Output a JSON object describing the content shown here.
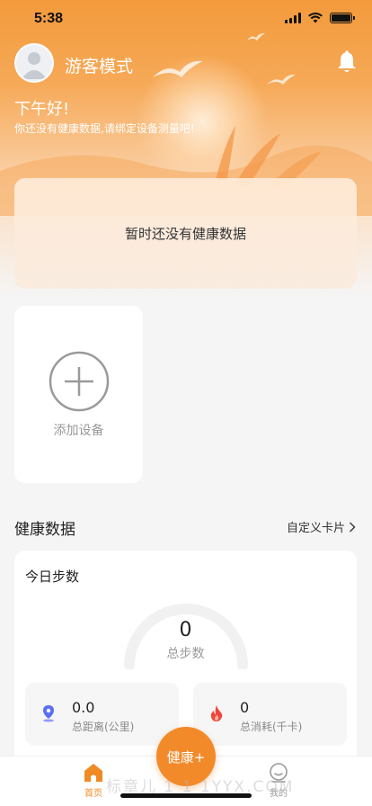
{
  "status_bar": {
    "time": "5:38"
  },
  "header": {
    "username": "游客模式",
    "greeting": "下午好!",
    "greeting_sub": "你还没有健康数据,请绑定设备测量吧!"
  },
  "data_card": {
    "empty_text": "暂时还没有健康数据"
  },
  "add_device": {
    "label": "添加设备"
  },
  "health_section": {
    "title": "健康数据",
    "custom_link": "自定义卡片",
    "steps_card": {
      "title": "今日步数",
      "steps_value": "0",
      "steps_label": "总步数",
      "distance": {
        "value": "0.0",
        "label": "总距离(公里)"
      },
      "calories": {
        "value": "0",
        "label": "总消耗(千卡)"
      }
    }
  },
  "tabbar": {
    "home_label": "首页",
    "health_label": "健康+",
    "mine_label": "我的"
  },
  "watermark": "标章儿 1 1 1YYX.COM",
  "colors": {
    "accent": "#f28a2a",
    "header_gradient_top": "#f39a3c"
  }
}
